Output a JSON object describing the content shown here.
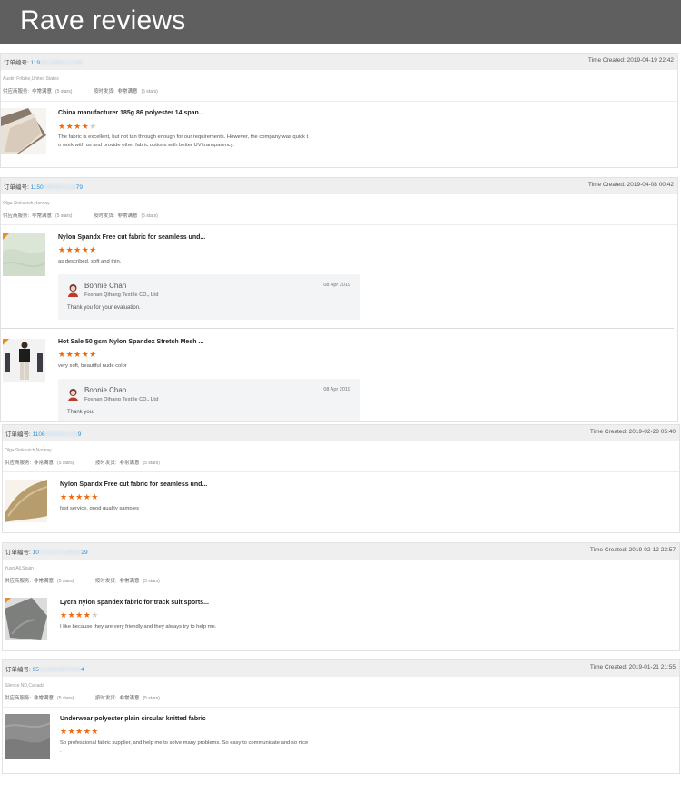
{
  "banner": {
    "title": "Rave reviews"
  },
  "labels": {
    "order_label": "订单编号:",
    "time_created_label": "Time Created:",
    "supplier_service": "供应商服务:",
    "on_time_shipping": "按时发货:",
    "rating_value": "非常满意",
    "stars_text": "(5 stars)"
  },
  "reviews": [
    {
      "order_prefix": "119",
      "order_blur": "8013986112788",
      "order_suffix": "",
      "time": "2019-04-19 22:42",
      "buyer": "Austin Fritzke,United States",
      "items": [
        {
          "title": "China manufacturer 185g 86 polyester 14 span...",
          "rating": 4,
          "text_lines": [
            "The fabric is excellent, but not tan through enough for our requirements. However, the company was quick t",
            "o work with us and provide other fabric options with better UV transparency."
          ]
        }
      ]
    },
    {
      "order_prefix": "1150",
      "order_blur": "8980881028",
      "order_suffix": "79",
      "time": "2019-04-08 00:42",
      "buyer": "Olga Sinkevich,Norway",
      "items": [
        {
          "title": "Nylon Spandx Free cut fabric for seamless und...",
          "rating": 5,
          "text_lines": [
            "as described, soft and thin."
          ],
          "reply": {
            "name": "Bonnie Chan",
            "company": "Foshan Qihang Textile CO., Ltd",
            "date": "08 Apr 2019",
            "text": "Thank you for your evaluation."
          }
        },
        {
          "title": "Hot Sale 50 gsm Nylon Spandex Stretch Mesh ...",
          "rating": 5,
          "text_lines": [
            "very soft, beautiful nude color"
          ],
          "reply": {
            "name": "Bonnie Chan",
            "company": "Foshan Qihang Textile CO., Ltd",
            "date": "08 Apr 2019",
            "text": "Thank you."
          }
        }
      ]
    },
    {
      "order_prefix": "1106",
      "order_blur": "8980881028",
      "order_suffix": "9",
      "time": "2019-02-28 05:40",
      "buyer": "Olga Sinkevich,Norway",
      "items": [
        {
          "title": "Nylon Spandx Free cut fabric for seamless und...",
          "rating": 5,
          "text_lines": [
            "fast service, good quality samples"
          ]
        }
      ]
    },
    {
      "order_prefix": "10",
      "order_blur": "1141872018534",
      "order_suffix": "29",
      "time": "2019-02-12 23:57",
      "buyer": "Yusri Ali,Spain",
      "items": [
        {
          "title": "Lycra nylon spandex fabric for track suit sports...",
          "rating": 4,
          "text_lines": [
            "I like because they are very friendly and they always try to help me."
          ]
        }
      ]
    },
    {
      "order_prefix": "95",
      "order_blur": "1118643857816",
      "order_suffix": "4",
      "time": "2019-01-21 21:55",
      "buyer": "Silence ND,Canada",
      "items": [
        {
          "title": "Underwear polyester plain circular knitted fabric",
          "rating": 5,
          "text_lines": [
            "So professional fabric supplier, and help me to solve many problems. So easy to communicate and so nice",
            "."
          ]
        }
      ]
    }
  ],
  "colors": {
    "banner": "#5f5f5f",
    "star_on": "#f06a0f",
    "star_off": "#cfcfcf",
    "order_id": "#2a8fd8",
    "head_bg": "#efefef"
  }
}
